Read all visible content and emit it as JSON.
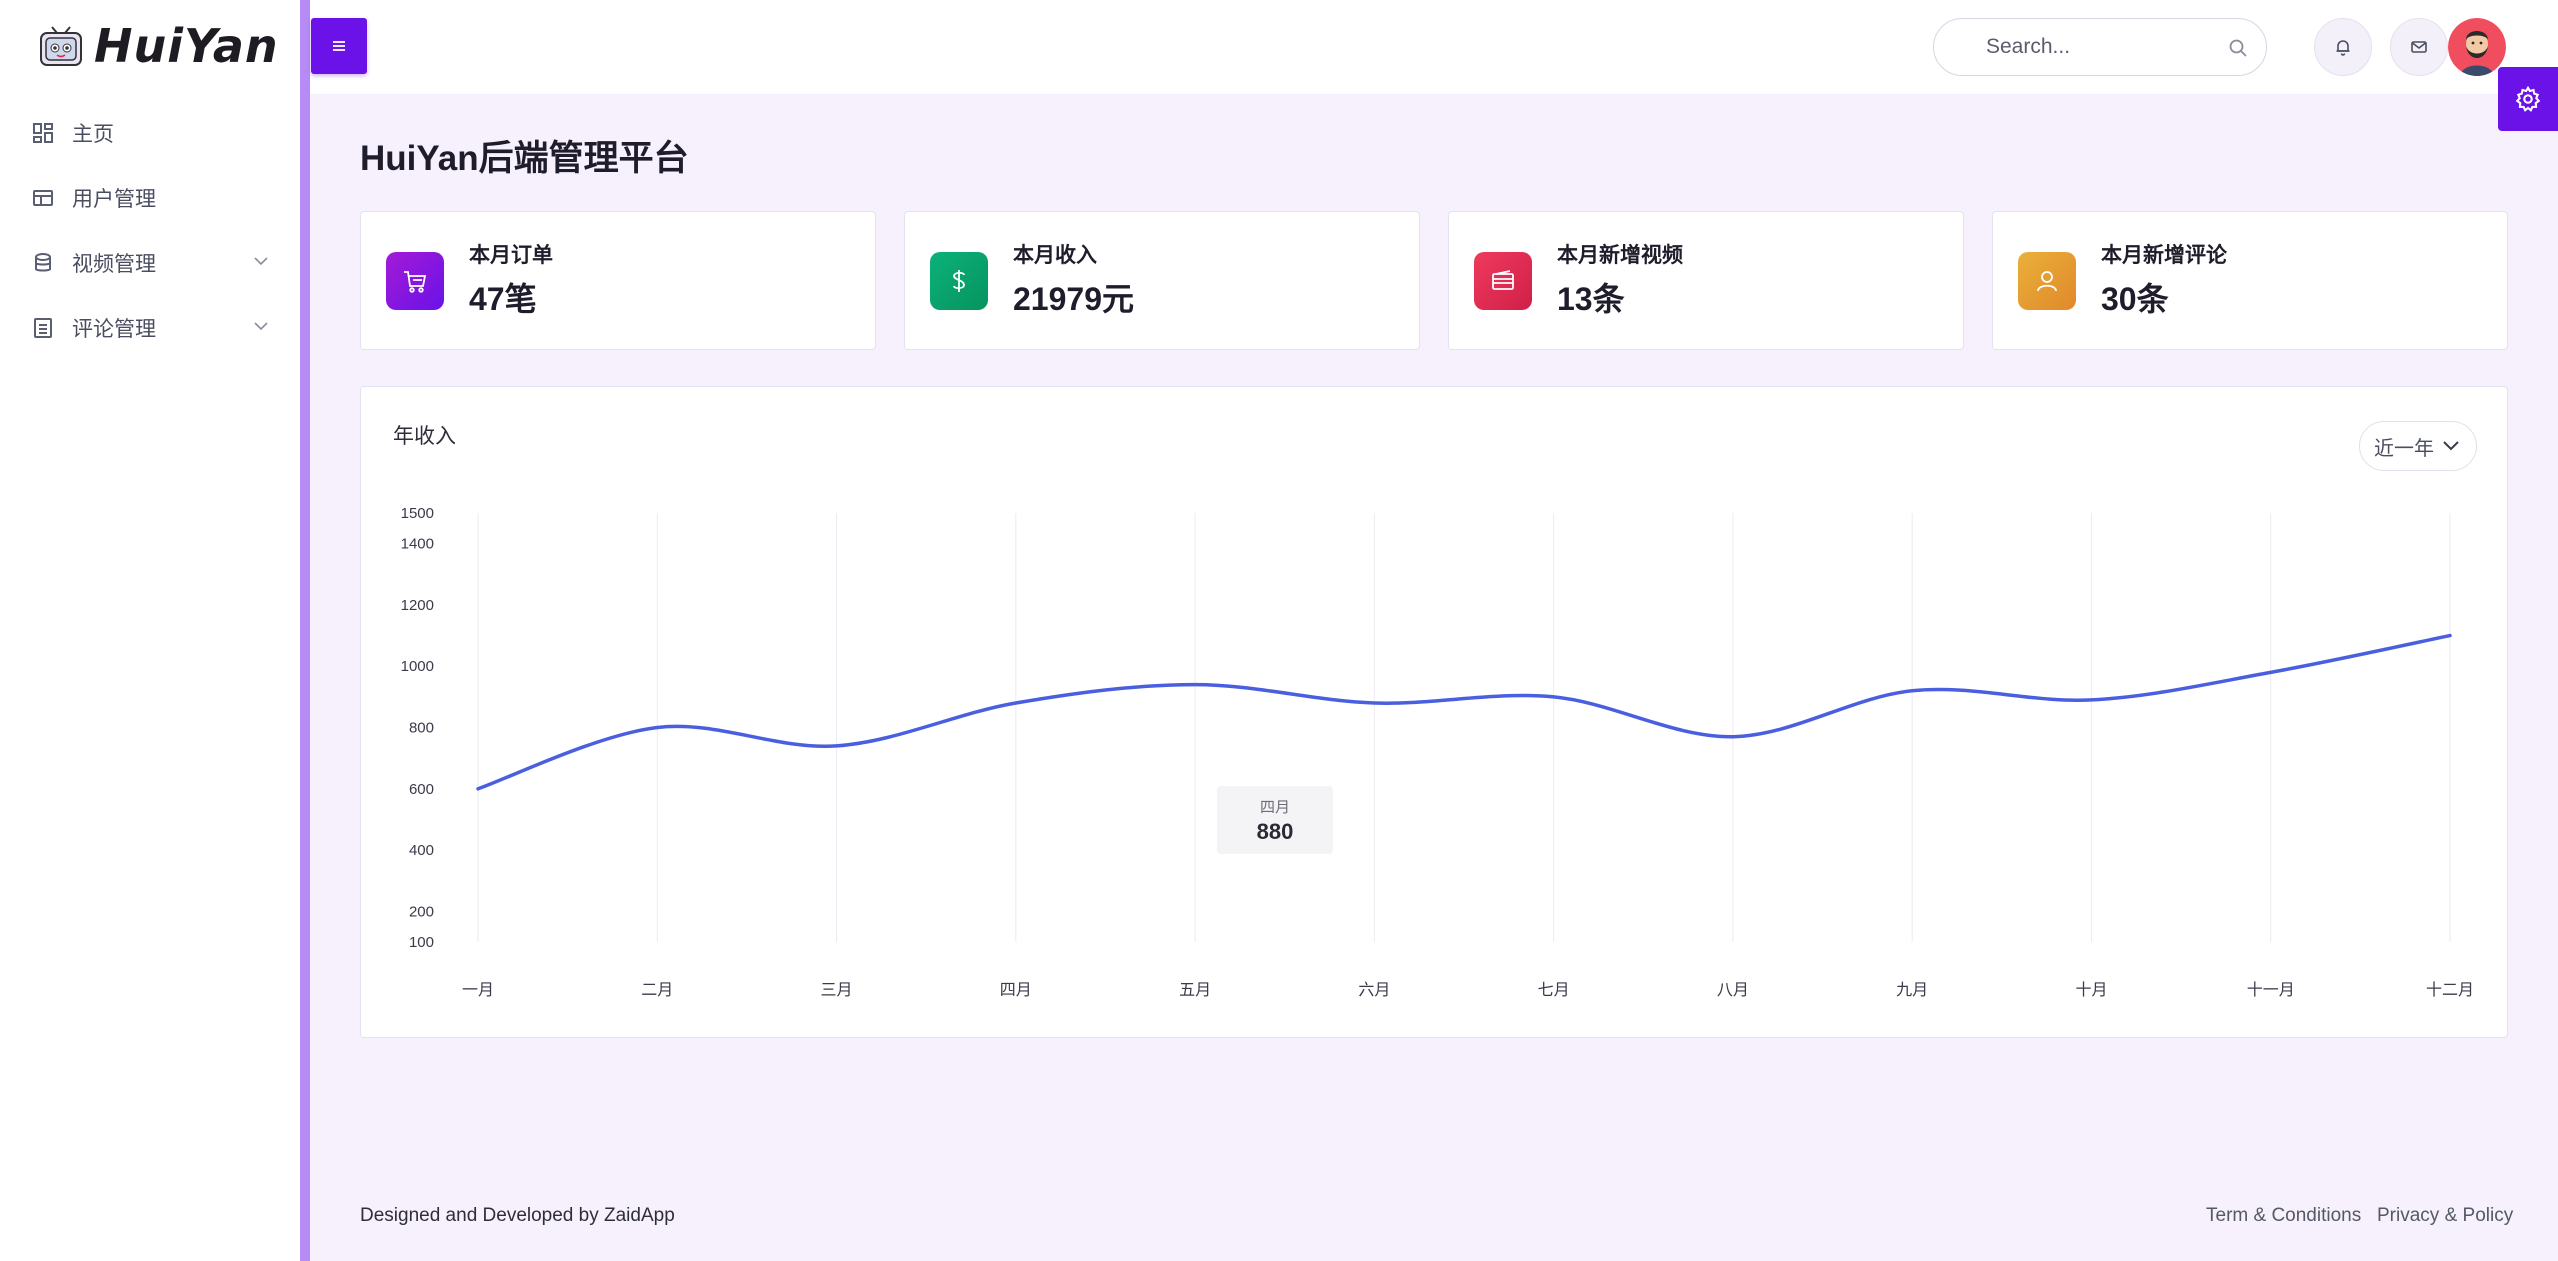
{
  "brand": {
    "name": "HuiYan"
  },
  "sidebar": {
    "items": [
      {
        "label": "主页",
        "icon": "dashboard-icon",
        "expandable": false
      },
      {
        "label": "用户管理",
        "icon": "table-icon",
        "expandable": false
      },
      {
        "label": "视频管理",
        "icon": "database-icon",
        "expandable": true
      },
      {
        "label": "评论管理",
        "icon": "list-icon",
        "expandable": true
      }
    ]
  },
  "header": {
    "search_placeholder": "Search...",
    "icons": [
      "menu-icon",
      "search-icon",
      "bell-icon",
      "mail-icon",
      "avatar",
      "gear-icon"
    ]
  },
  "page": {
    "title": "HuiYan后端管理平台"
  },
  "stats": [
    {
      "title": "本月订单",
      "value": "47笔",
      "icon": "cart-icon",
      "color": "#8b17d6"
    },
    {
      "title": "本月收入",
      "value": "21979元",
      "icon": "dollar-icon",
      "color": "#08a36b"
    },
    {
      "title": "本月新增视频",
      "value": "13条",
      "icon": "card-icon",
      "color": "#e0294f"
    },
    {
      "title": "本月新增评论",
      "value": "30条",
      "icon": "user-icon",
      "color": "#e49a2a"
    }
  ],
  "chart": {
    "title": "年收入",
    "range_label": "近一年",
    "tooltip": {
      "label": "四月",
      "value": "880"
    }
  },
  "chart_data": {
    "type": "line",
    "title": "年收入",
    "categories": [
      "一月",
      "二月",
      "三月",
      "四月",
      "五月",
      "六月",
      "七月",
      "八月",
      "九月",
      "十月",
      "十一月",
      "十二月"
    ],
    "series": [
      {
        "values": [
          600,
          800,
          740,
          880,
          940,
          880,
          900,
          770,
          920,
          890,
          980,
          1100
        ],
        "color": "#4a5fe0"
      }
    ],
    "y_ticks": [
      100,
      200,
      400,
      600,
      800,
      1000,
      1200,
      1400,
      1500
    ],
    "ylim": [
      100,
      1500
    ],
    "grid": "vertical"
  },
  "footer": {
    "credit": "Designed and Developed by ZaidApp",
    "links": [
      "Term & Conditions",
      "Privacy & Policy"
    ]
  }
}
